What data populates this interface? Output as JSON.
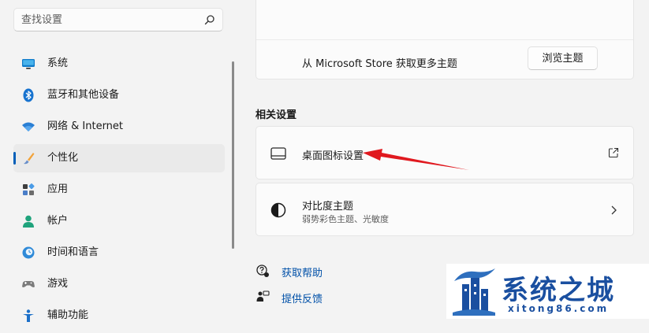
{
  "search": {
    "placeholder": "查找设置",
    "icon": "search-icon"
  },
  "sidebar": {
    "items": [
      {
        "label": "系统",
        "icon": "monitor-icon",
        "selected": false
      },
      {
        "label": "蓝牙和其他设备",
        "icon": "bluetooth-icon",
        "selected": false
      },
      {
        "label": "网络 & Internet",
        "icon": "wifi-icon",
        "selected": false
      },
      {
        "label": "个性化",
        "icon": "brush-icon",
        "selected": true
      },
      {
        "label": "应用",
        "icon": "apps-icon",
        "selected": false
      },
      {
        "label": "帐户",
        "icon": "person-icon",
        "selected": false
      },
      {
        "label": "时间和语言",
        "icon": "clock-globe-icon",
        "selected": false
      },
      {
        "label": "游戏",
        "icon": "gamepad-icon",
        "selected": false
      },
      {
        "label": "辅助功能",
        "icon": "accessibility-icon",
        "selected": false
      }
    ]
  },
  "themes": {
    "store_text": "从 Microsoft Store 获取更多主题",
    "browse_button": "浏览主题"
  },
  "related": {
    "title": "相关设置",
    "desktop_icons": {
      "label": "桌面图标设置",
      "icon": "desktop-icon",
      "action_icon": "open-external-icon"
    },
    "contrast": {
      "label": "对比度主题",
      "sublabel": "弱势彩色主题、光敏度",
      "icon": "contrast-icon",
      "action_icon": "chevron-right-icon"
    }
  },
  "links": {
    "help": {
      "label": "获取帮助",
      "icon": "help-icon"
    },
    "feedback": {
      "label": "提供反馈",
      "icon": "feedback-icon"
    }
  },
  "watermark": {
    "title": "系统之城",
    "url": "xitong86.com"
  },
  "colors": {
    "accent": "#005fb8",
    "link": "#0050a8",
    "annotation_arrow": "#e0191f",
    "watermark_blue": "#1a4fa0"
  }
}
